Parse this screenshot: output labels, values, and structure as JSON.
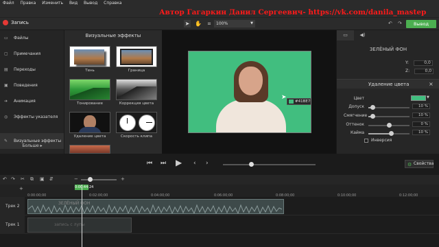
{
  "menu": [
    "Файл",
    "Правка",
    "Изменить",
    "Вид",
    "Вывод",
    "Справка"
  ],
  "watermark": "Автор Гагаркин Данил Сергеевич- https://vk.com/danila_mastep",
  "toolbar": {
    "record_label": "Запись",
    "zoom": "100%",
    "export_label": "Вывод"
  },
  "sidebar": {
    "items": [
      {
        "label": "Файлы",
        "icon": "film-icon"
      },
      {
        "label": "Примечания",
        "icon": "note-icon"
      },
      {
        "label": "Переходы",
        "icon": "transition-icon"
      },
      {
        "label": "Поведения",
        "icon": "behavior-icon"
      },
      {
        "label": "Анимация",
        "icon": "animation-icon"
      },
      {
        "label": "Эффекты указателя",
        "icon": "cursor-effect-icon"
      },
      {
        "label": "Визуальные эффекты",
        "icon": "visual-effects-icon"
      }
    ],
    "more": "Больше ▸"
  },
  "effects": {
    "title": "Визуальные эффекты",
    "tiles": [
      {
        "label": "Тень"
      },
      {
        "label": "Граница"
      },
      {
        "label": "Тонирование"
      },
      {
        "label": "Коррекция цвета"
      },
      {
        "label": "Удаление цвета"
      },
      {
        "label": "Скорость клипа"
      }
    ]
  },
  "canvas": {
    "tooltip": "#41BE7F",
    "key_color": "#41be7f"
  },
  "props": {
    "layer_name": "ЗЕЛЁНЫЙ ФОН",
    "x_label": "Y:",
    "x_val": "0,0",
    "y_label": "Z:",
    "y_val": "0,0",
    "section": "Удаление цвета",
    "color_label": "Цвет",
    "tolerance_label": "Допуск",
    "tolerance": "10 %",
    "softness_label": "Смягчение",
    "softness": "10 %",
    "hue_label": "Оттенок",
    "hue": "0 %",
    "defringe_label": "Кайма",
    "defringe": "10 %",
    "invert_label": "Инверсия"
  },
  "playback": {
    "props_label": "Свойства"
  },
  "timeline": {
    "playhead_time": "0:00:44;24",
    "ticks": [
      "0:00:00;00",
      "0:02:00;00",
      "0:04:00;00",
      "0:06:00;00",
      "0:08:00;00",
      "0:10:00;00",
      "0:12:00;00"
    ],
    "tracks": [
      {
        "name": "Трек 2",
        "clip": "ЗЕЛЁНЫЙ ФОН"
      },
      {
        "name": "Трек 1",
        "clip": "запись с лупы"
      }
    ]
  }
}
